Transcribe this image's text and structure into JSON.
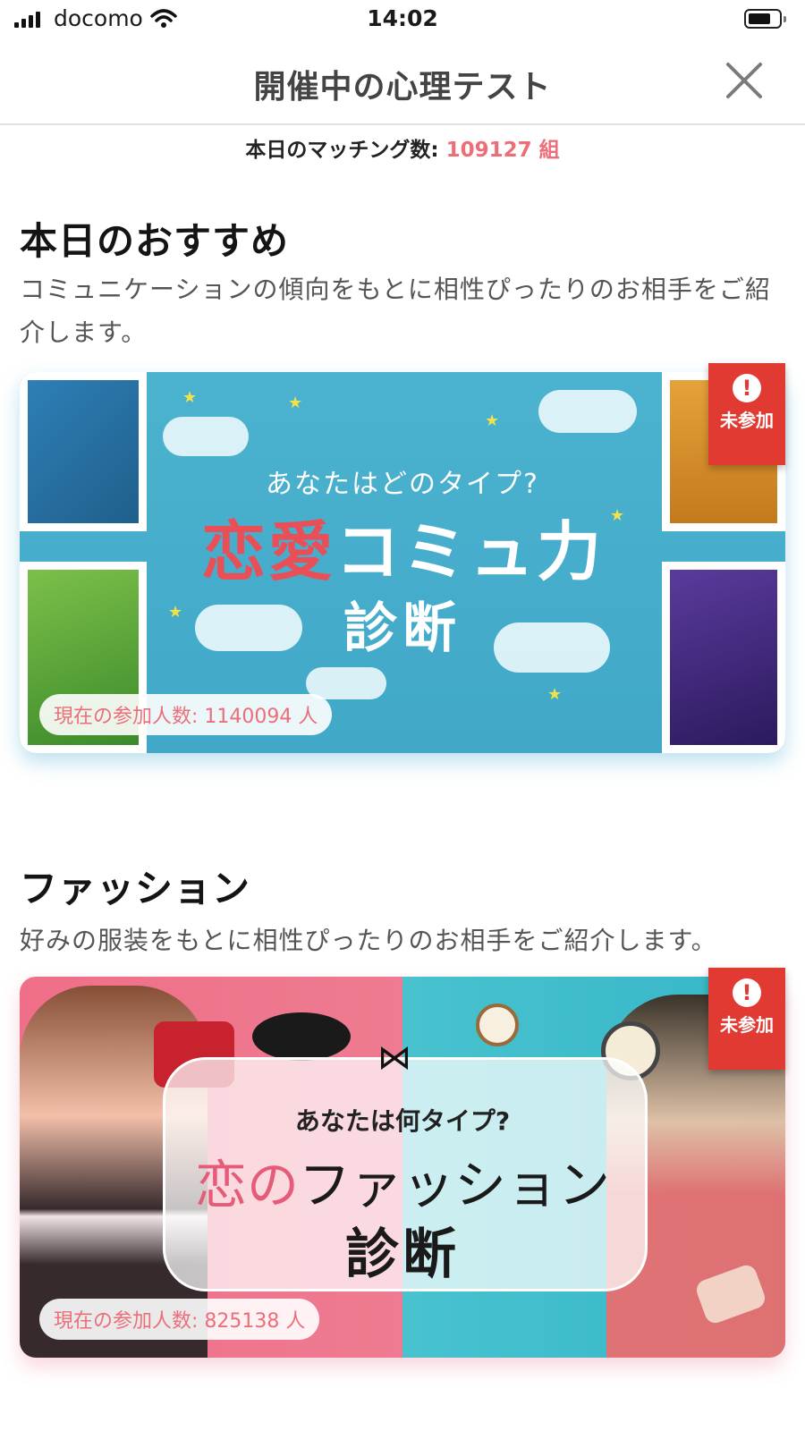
{
  "status_bar": {
    "carrier": "docomo",
    "time": "14:02"
  },
  "nav": {
    "title": "開催中の心理テスト"
  },
  "matching": {
    "label": "本日のマッチング数: ",
    "count": "109127 組"
  },
  "sections": [
    {
      "title": "本日のおすすめ",
      "description": "コミュニケーションの傾向をもとに相性ぴったりのお相手をご紹介します。",
      "banner": {
        "subtitle": "あなたはどのタイプ?",
        "title_red": "恋愛",
        "title_white": "コミュ力",
        "title_line2": "診断",
        "badge": "未参加",
        "participants": "現在の参加人数: 1140094 人"
      }
    },
    {
      "title": "ファッション",
      "description": "好みの服装をもとに相性ぴったりのお相手をご紹介します。",
      "banner": {
        "subtitle": "あなたは何タイプ?",
        "title_pink": "恋の",
        "title_dark": "ファッション",
        "title_line2": "診断",
        "badge": "未参加",
        "participants": "現在の参加人数: 825138 人"
      }
    }
  ],
  "colors": {
    "accent": "#ec6e78",
    "badge": "#e03a32",
    "teal": "#45acc9",
    "pink": "#ef6f88"
  },
  "icons": [
    "signal-icon",
    "wifi-icon",
    "battery-icon",
    "close-icon",
    "alert-icon"
  ]
}
